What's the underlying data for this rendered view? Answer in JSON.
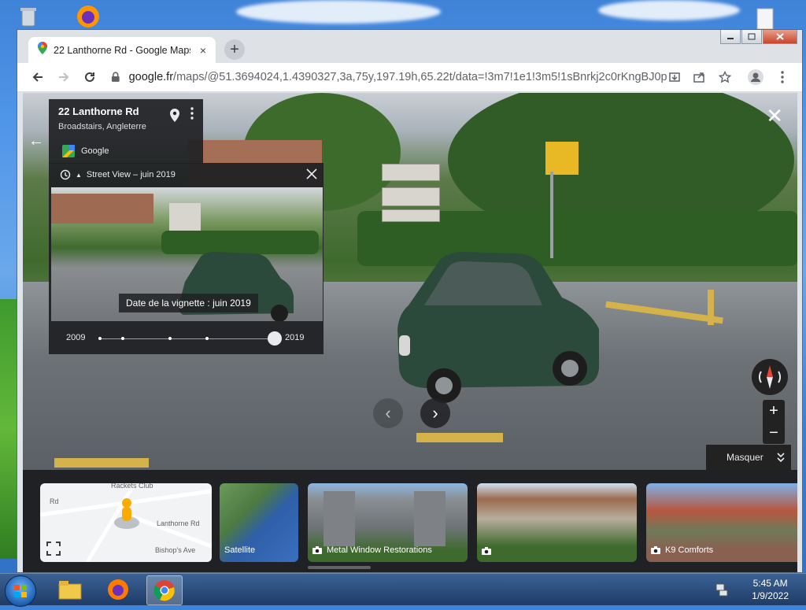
{
  "browser": {
    "tab_title": "22 Lanthorne Rd - Google Maps",
    "tab_close": "×",
    "new_tab": "+",
    "url_host": "google.fr",
    "url_path": "/maps/@51.3694024,1.4390327,3a,75y,197.19h,65.22t/data=!3m7!1e1!3m5!1sBnrkj2c0rKngBJ0p1..."
  },
  "place": {
    "name": "22 Lanthorne Rd",
    "region": "Broadstairs, Angleterre",
    "provider": "Google"
  },
  "timemachine": {
    "header": "Street View – juin 2019",
    "thumb_date": "Date de la vignette : juin 2019",
    "year_start": "2009",
    "year_end": "2019",
    "selected_fraction": 1.0
  },
  "controls": {
    "zoom_in": "+",
    "zoom_out": "−",
    "hide_label": "Masquer",
    "close": "✕",
    "back": "←"
  },
  "strip": {
    "map_labels": [
      "Rackets Club",
      "Rd",
      "Lanthorne Rd",
      "Bishop's Ave"
    ],
    "satellite_label": "Satellite",
    "photos": [
      {
        "label": "Metal Window Restorations"
      },
      {
        "label": ""
      },
      {
        "label": "K9 Comforts"
      }
    ]
  },
  "taskbar": {
    "time": "5:45 AM",
    "date": "1/9/2022"
  },
  "colors": {
    "panel_bg": "#202124",
    "accent_yellow": "#e8b825"
  }
}
